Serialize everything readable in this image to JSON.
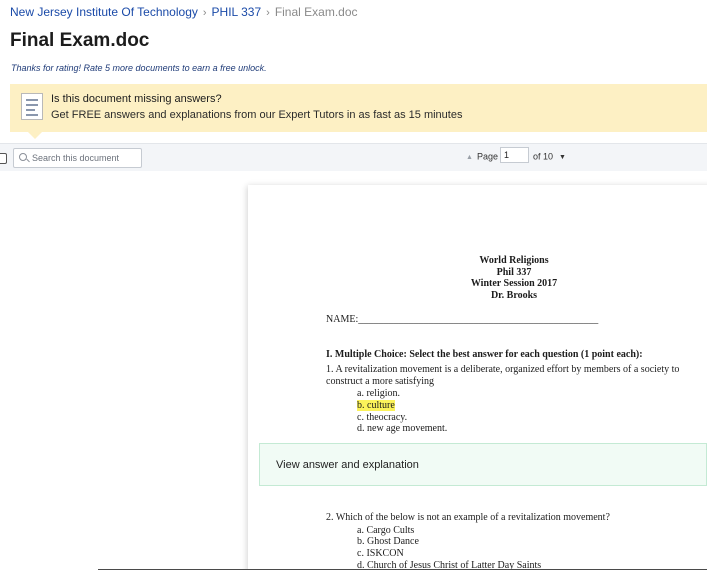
{
  "breadcrumb": {
    "items": [
      "New Jersey Institute Of Technology",
      "PHIL 337",
      "Final Exam.doc"
    ]
  },
  "page_title": "Final Exam.doc",
  "rating_note": "Thanks for rating! Rate 5 more documents to earn a free unlock.",
  "banner": {
    "question": "Is this document missing answers?",
    "subtitle": "Get FREE answers and explanations from our Expert Tutors in as fast as 15 minutes",
    "background": "#fdf0c4"
  },
  "toolbar": {
    "search_placeholder": "Search this document",
    "page_label": "Page",
    "page_value": "1",
    "page_total": "of 10"
  },
  "document": {
    "header": [
      "World Religions",
      "Phil 337",
      "Winter Session 2017",
      "Dr. Brooks"
    ],
    "name_line": "NAME:________________________________________________",
    "section_heading": "I. Multiple Choice: Select the best answer for each question (1 point each):",
    "q1_line1": "1. A revitalization movement is a deliberate, organized effort by members of a society to",
    "q1_line2": "construct a more satisfying",
    "q1_options": [
      "a. religion.",
      "b. culture",
      "c. theocracy.",
      "d. new age movement."
    ],
    "q2": "2. Which of the below is not an example of a revitalization movement?",
    "q2_options": [
      "a. Cargo Cults",
      "b. Ghost Dance",
      "c. ISKCON",
      "d. Church of Jesus Christ of Latter Day Saints"
    ],
    "highlight_color": "#fbf25a"
  },
  "answer_button": "View answer and explanation"
}
